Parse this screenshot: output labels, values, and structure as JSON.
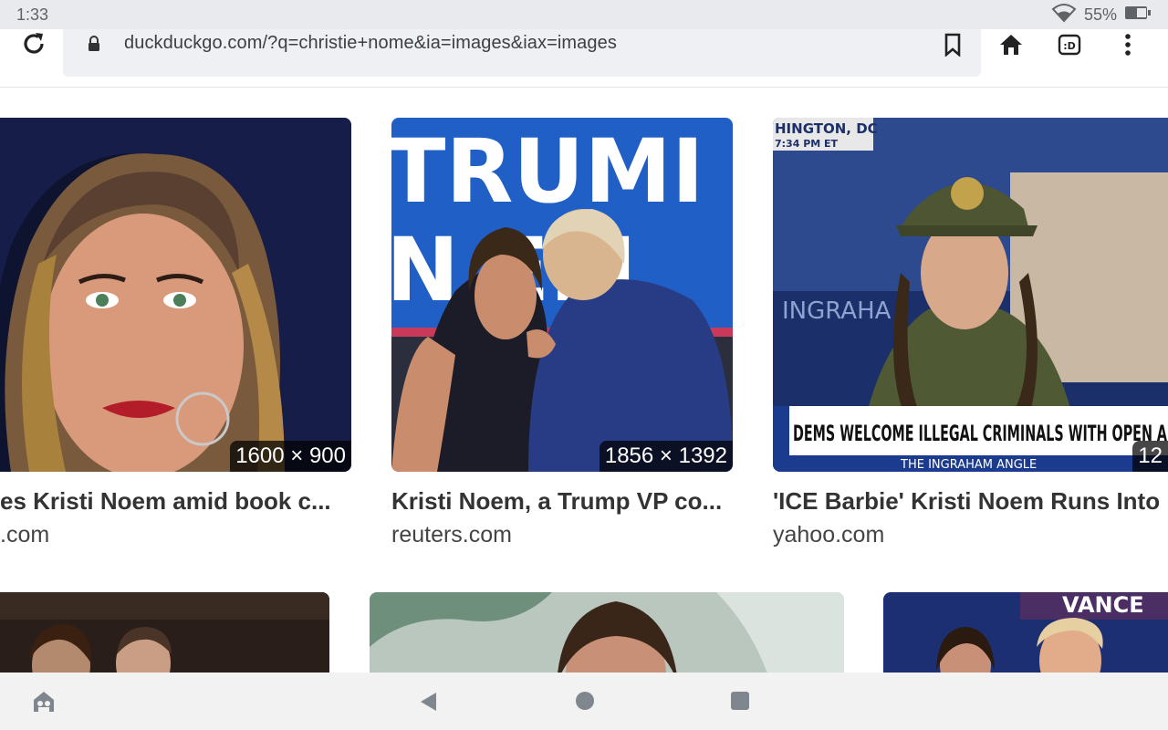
{
  "status_bar": {
    "time": "1:33",
    "battery": "55%"
  },
  "browser": {
    "url": "duckduckgo.com/?q=christie+nome&ia=images&iax=images"
  },
  "results": [
    {
      "title": "es Kristi Noem amid book c...",
      "domain": ".com",
      "dims": "1600 × 900"
    },
    {
      "title": "Kristi Noem, a Trump VP co...",
      "domain": "reuters.com",
      "dims": "1856 × 1392"
    },
    {
      "title": "'ICE Barbie' Kristi Noem Runs Into",
      "domain": "yahoo.com",
      "dims": "12"
    }
  ],
  "thumb_overlays": {
    "trump_sign_top": "TRUMI",
    "trump_sign_bottom": "N  EM",
    "news_location": "HINGTON, DC",
    "news_time": "7:34 PM ET",
    "news_show": "INGRAHA",
    "news_headline": "DEMS WELCOME ILLEGAL CRIMINALS WITH OPEN A",
    "news_brand": "THE INGRAHAM ANGLE",
    "vance_sign": "VANCE"
  },
  "colors": {
    "status_bg": "#e8eaee",
    "omnibox_bg": "#eef0f3",
    "nav_bg": "#f2f2f2",
    "title_color": "#333333"
  }
}
